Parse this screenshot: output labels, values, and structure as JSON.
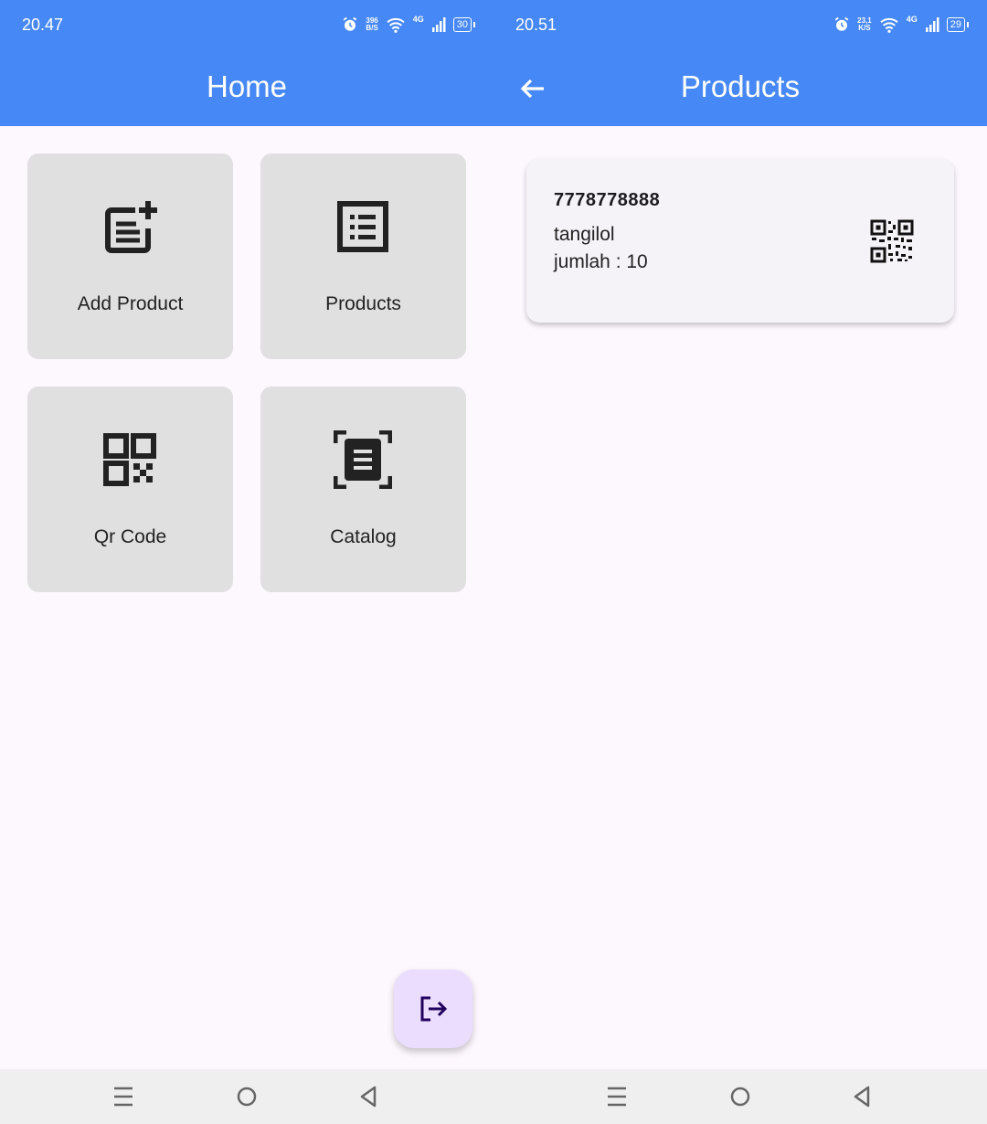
{
  "colors": {
    "primary": "#4688f6",
    "background": "#fdf7fe",
    "tile": "#e0e0e0",
    "fab": "#eaddfe",
    "card": "#f5f2f8"
  },
  "left_screen": {
    "status": {
      "time": "20.47",
      "speed_value": "396",
      "speed_unit": "B/S",
      "network": "4G",
      "battery": "30"
    },
    "appbar": {
      "title": "Home"
    },
    "tiles": [
      {
        "label": "Add Product",
        "icon": "post-add-icon"
      },
      {
        "label": "Products",
        "icon": "list-alt-icon"
      },
      {
        "label": "Qr Code",
        "icon": "qr-code-icon"
      },
      {
        "label": "Catalog",
        "icon": "document-scanner-icon"
      }
    ],
    "fab": {
      "icon": "logout-icon"
    }
  },
  "right_screen": {
    "status": {
      "time": "20.51",
      "speed_value": "23,1",
      "speed_unit": "K/S",
      "network": "4G",
      "battery": "29"
    },
    "appbar": {
      "title": "Products",
      "back_icon": "arrow-back-icon"
    },
    "products": [
      {
        "code": "7778778888",
        "name": "tangilol",
        "quantity": "jumlah : 10",
        "icon": "qr-code-icon"
      }
    ]
  },
  "navbar": {
    "icons": [
      "menu-icon",
      "home-circle-icon",
      "back-triangle-icon"
    ]
  }
}
